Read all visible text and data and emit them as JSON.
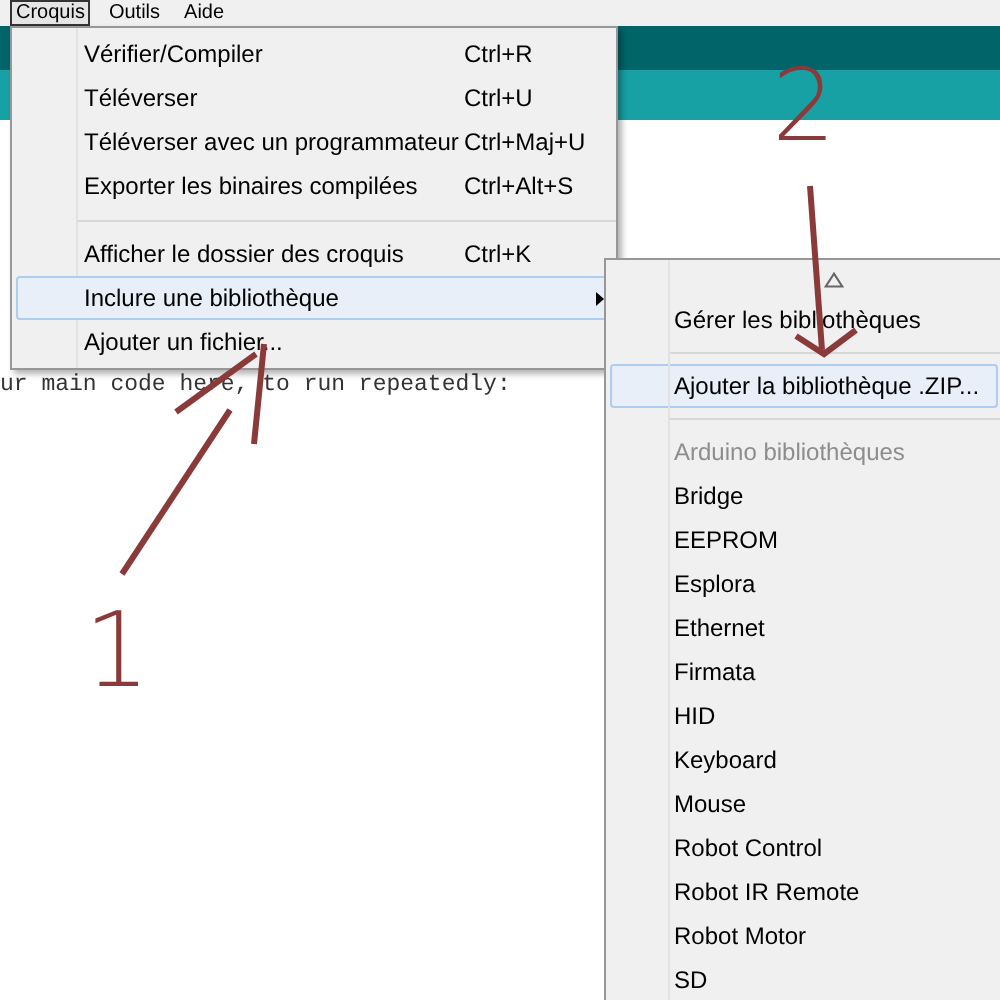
{
  "menu_bar": [
    {
      "label": "Croquis",
      "selected": true
    },
    {
      "label": "Outils",
      "selected": false
    },
    {
      "label": "Aide",
      "selected": false
    }
  ],
  "editor": {
    "code_line": "ur main code here, to run repeatedly:"
  },
  "main_menu": {
    "items": [
      {
        "kind": "item",
        "label": "Vérifier/Compiler",
        "shortcut": "Ctrl+R",
        "selected": false
      },
      {
        "kind": "item",
        "label": "Téléverser",
        "shortcut": "Ctrl+U",
        "selected": false
      },
      {
        "kind": "item",
        "label": "Téléverser avec un programmateur",
        "shortcut": "Ctrl+Maj+U",
        "selected": false
      },
      {
        "kind": "item",
        "label": "Exporter les binaires compilées",
        "shortcut": "Ctrl+Alt+S",
        "selected": false
      },
      {
        "kind": "separator"
      },
      {
        "kind": "item",
        "label": "Afficher le dossier des croquis",
        "shortcut": "Ctrl+K",
        "selected": false
      },
      {
        "kind": "submenu",
        "label": "Inclure une bibliothèque",
        "selected": true
      },
      {
        "kind": "item",
        "label": "Ajouter un fichier...",
        "selected": false
      }
    ]
  },
  "submenu": {
    "items": [
      {
        "kind": "scroll_up"
      },
      {
        "kind": "item",
        "label": "Gérer les bibliothèques",
        "selected": false
      },
      {
        "kind": "separator"
      },
      {
        "kind": "item",
        "label": "Ajouter la bibliothèque .ZIP...",
        "selected": true
      },
      {
        "kind": "separator"
      },
      {
        "kind": "header",
        "label": "Arduino bibliothèques"
      },
      {
        "kind": "item",
        "label": "Bridge",
        "selected": false
      },
      {
        "kind": "item",
        "label": "EEPROM",
        "selected": false
      },
      {
        "kind": "item",
        "label": "Esplora",
        "selected": false
      },
      {
        "kind": "item",
        "label": "Ethernet",
        "selected": false
      },
      {
        "kind": "item",
        "label": "Firmata",
        "selected": false
      },
      {
        "kind": "item",
        "label": "HID",
        "selected": false
      },
      {
        "kind": "item",
        "label": "Keyboard",
        "selected": false
      },
      {
        "kind": "item",
        "label": "Mouse",
        "selected": false
      },
      {
        "kind": "item",
        "label": "Robot Control",
        "selected": false
      },
      {
        "kind": "item",
        "label": "Robot IR Remote",
        "selected": false
      },
      {
        "kind": "item",
        "label": "Robot Motor",
        "selected": false
      },
      {
        "kind": "item",
        "label": "SD",
        "selected": false
      }
    ]
  },
  "annotations": [
    {
      "label": "1"
    },
    {
      "label": "2"
    }
  ]
}
